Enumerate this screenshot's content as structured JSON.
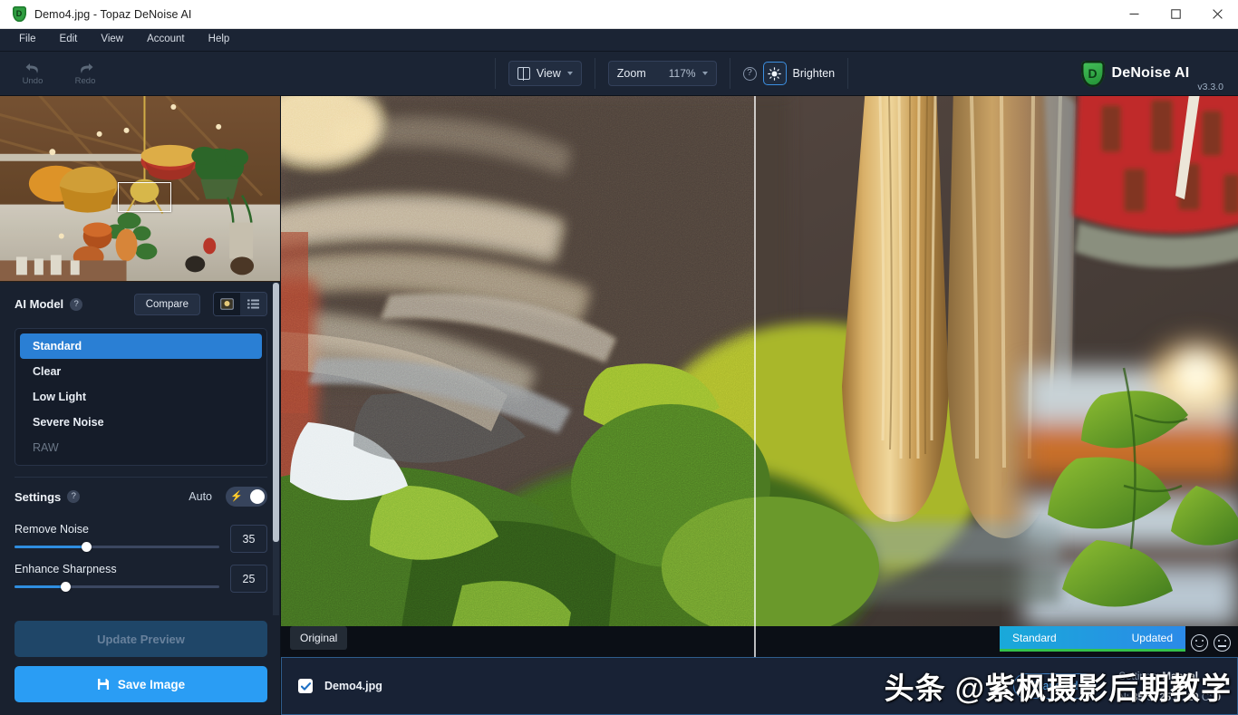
{
  "window": {
    "title": "Demo4.jpg - Topaz DeNoise AI",
    "app_icon": "shield-icon",
    "shield_letter": "D",
    "minimize": "minimize-icon",
    "maximize": "maximize-icon",
    "close": "close-icon"
  },
  "menubar": {
    "items": [
      {
        "label": "File"
      },
      {
        "label": "Edit"
      },
      {
        "label": "View"
      },
      {
        "label": "Account"
      },
      {
        "label": "Help"
      }
    ]
  },
  "toolbar": {
    "undo": "Undo",
    "redo": "Redo",
    "view_label": "View",
    "zoom_label": "Zoom",
    "zoom_value": "117%",
    "help_glyph": "?",
    "brighten_label": "Brighten",
    "brand_name": "DeNoise AI",
    "brand_version": "v3.3.0"
  },
  "navigator": {
    "viewport_rect": "viewport-rectangle"
  },
  "ai_model": {
    "title": "AI Model",
    "compare_label": "Compare",
    "icon_preview": "image-preview-icon",
    "icon_list": "list-view-icon",
    "models": [
      {
        "label": "Standard",
        "state": "selected"
      },
      {
        "label": "Clear",
        "state": "normal"
      },
      {
        "label": "Low Light",
        "state": "normal"
      },
      {
        "label": "Severe Noise",
        "state": "normal"
      },
      {
        "label": "RAW",
        "state": "disabled"
      }
    ]
  },
  "settings": {
    "title": "Settings",
    "auto_label": "Auto",
    "auto_on": true,
    "sliders": [
      {
        "label": "Remove Noise",
        "value": "35",
        "percent": 35
      },
      {
        "label": "Enhance Sharpness",
        "value": "25",
        "percent": 25
      }
    ]
  },
  "actions": {
    "update_preview": "Update Preview",
    "save_image": "Save Image",
    "save_icon": "floppy-disk-icon"
  },
  "canvas": {
    "original_badge": "Original",
    "status_model": "Standard",
    "status_state": "Updated",
    "face_good": "smiley-face-icon",
    "face_bad": "neutral-face-icon"
  },
  "filebar": {
    "checked": true,
    "filename": "Demo4.jpg",
    "model_pill": "Standard",
    "settings_label": "Settings:",
    "settings_mode": "Manual",
    "params": [
      {
        "key": "N:",
        "value": "35"
      },
      {
        "key": "S:",
        "value": "25"
      },
      {
        "key": "R:",
        "value": "10"
      },
      {
        "key": "C:",
        "value": "0"
      }
    ],
    "watermark": "头条 @紫枫摄影后期教学"
  },
  "colors": {
    "accent_blue": "#2a9df4",
    "selected_blue": "#2a7fd4",
    "panel_bg": "#19212f",
    "titlebar_bg": "#ffffff",
    "status_green": "#34c24a",
    "brand_green": "#2f9e41"
  }
}
